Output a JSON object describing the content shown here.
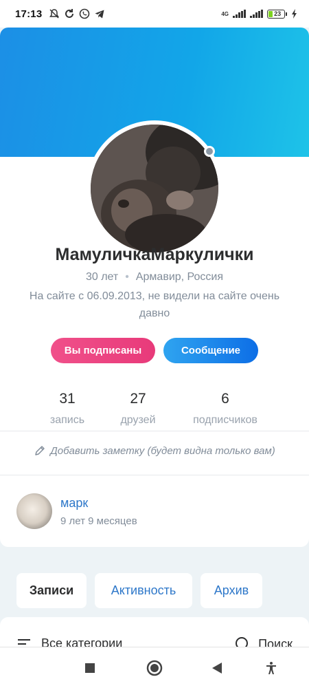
{
  "status_bar": {
    "time": "17:13",
    "network": "4G",
    "battery_level": "23"
  },
  "profile": {
    "name": "МамуличкаМаркулички",
    "age": "30 лет",
    "city": "Армавир, Россия",
    "seen": "На сайте с 06.09.2013, не видели на сайте очень давно",
    "online_status": "offline"
  },
  "actions": {
    "subscribed": "Вы подписаны",
    "message": "Сообщение"
  },
  "stats": [
    {
      "value": "31",
      "label": "запись"
    },
    {
      "value": "27",
      "label": "друзей"
    },
    {
      "value": "6",
      "label": "подписчиков"
    }
  ],
  "note": {
    "label": "Добавить заметку (будет видна только вам)"
  },
  "relative": {
    "name": "марк",
    "age": "9 лет 9 месяцев"
  },
  "tabs": [
    {
      "label": "Записи",
      "active": true
    },
    {
      "label": "Активность",
      "active": false
    },
    {
      "label": "Архив",
      "active": false
    }
  ],
  "filter": {
    "category": "Все категории",
    "search": "Поиск"
  },
  "colors": {
    "accent": "#2d77c9",
    "subscribed": "#e83a7a",
    "message": "#0d6ee6",
    "cover": "#1c8fe6"
  }
}
